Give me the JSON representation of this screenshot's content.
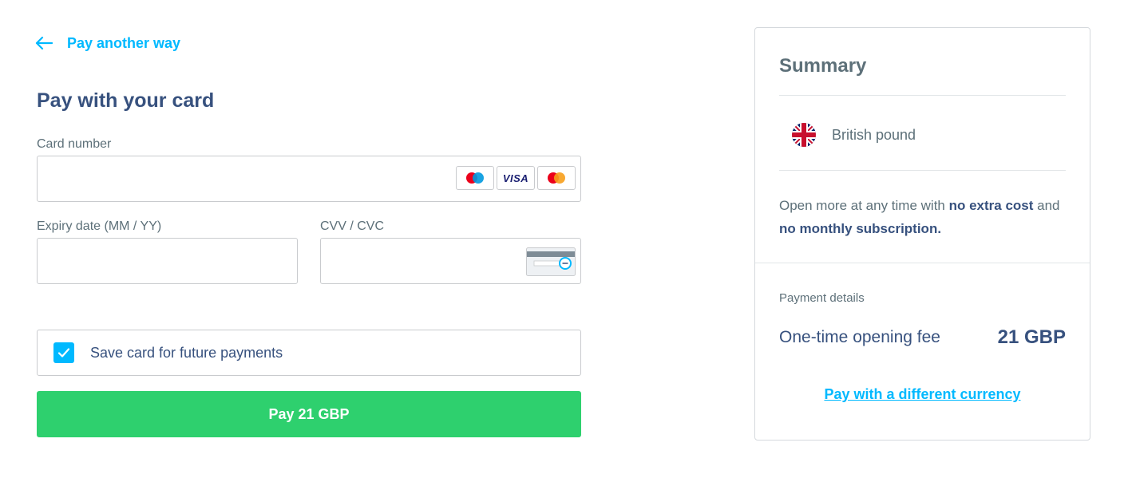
{
  "back_link": {
    "label": "Pay another way"
  },
  "form": {
    "title": "Pay with your card",
    "card_number": {
      "label": "Card number",
      "value": "",
      "placeholder": ""
    },
    "card_brands": [
      "maestro",
      "VISA",
      "mastercard"
    ],
    "expiry": {
      "label": "Expiry date (MM / YY)",
      "value": "",
      "placeholder": ""
    },
    "cvv": {
      "label": "CVV / CVC",
      "value": "",
      "placeholder": ""
    },
    "save_card": {
      "label": "Save card for future payments",
      "checked": true
    },
    "pay_button": {
      "label": "Pay 21 GBP"
    }
  },
  "summary": {
    "title": "Summary",
    "currency": {
      "name": "British pound",
      "flag_icon": "uk-flag-icon"
    },
    "promo": {
      "part1": "Open more at any time with ",
      "bold1": "no extra cost",
      "part2": " and ",
      "bold2": "no monthly subscription."
    },
    "payment_details_label": "Payment details",
    "fee": {
      "label": "One-time opening fee",
      "value": "21 GBP"
    },
    "different_currency_link": "Pay with a different currency"
  },
  "colors": {
    "accent": "#00b9ff",
    "pay_button": "#2ed06e",
    "heading": "#37517e",
    "muted": "#5d7079"
  }
}
